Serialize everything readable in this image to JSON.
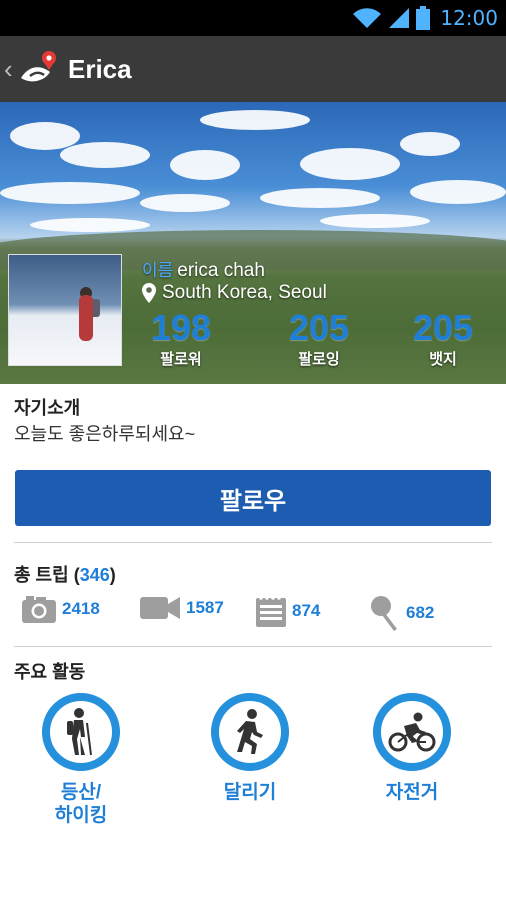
{
  "status_bar": {
    "time": "12:00"
  },
  "header": {
    "title": "Erica"
  },
  "profile": {
    "name_label": "이름",
    "name": "erica chah",
    "location": "South Korea, Seoul",
    "stats": [
      {
        "value": "198",
        "label": "팔로워"
      },
      {
        "value": "205",
        "label": "팔로잉"
      },
      {
        "value": "205",
        "label": "뱃지"
      }
    ]
  },
  "intro": {
    "title": "자기소개",
    "text": "오늘도 좋은하루되세요~"
  },
  "follow_button": {
    "label": "팔로우"
  },
  "trips": {
    "title": "총 트립",
    "total": "346",
    "items": [
      {
        "icon": "camera-icon",
        "count": "2418"
      },
      {
        "icon": "video-camera-icon",
        "count": "1587"
      },
      {
        "icon": "notepad-icon",
        "count": "874"
      },
      {
        "icon": "microphone-icon",
        "count": "682"
      }
    ]
  },
  "activities": {
    "title": "주요 활동",
    "items": [
      {
        "icon": "hiking-icon",
        "label": "등산/\n하이킹"
      },
      {
        "icon": "running-icon",
        "label": "달리기"
      },
      {
        "icon": "cycling-icon",
        "label": "자전거"
      }
    ]
  },
  "colors": {
    "accent": "#1f7fd6",
    "button": "#1c5db2",
    "actionbar": "#3a3a3a"
  }
}
